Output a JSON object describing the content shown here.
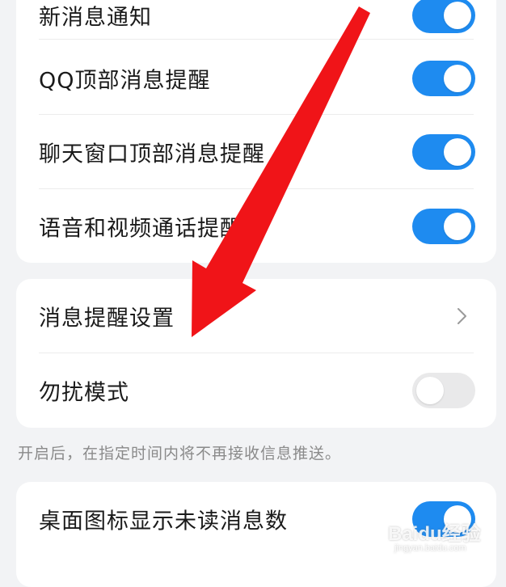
{
  "card1": {
    "rows": [
      {
        "label": "新消息通知",
        "toggle": "on"
      },
      {
        "label": "QQ顶部消息提醒",
        "toggle": "on"
      },
      {
        "label": "聊天窗口顶部消息提醒",
        "toggle": "on"
      },
      {
        "label": "语音和视频通话提醒",
        "toggle": "on"
      }
    ]
  },
  "card2": {
    "rows": [
      {
        "label": "消息提醒设置",
        "control": "chevron-right-icon"
      },
      {
        "label": "勿扰模式",
        "toggle": "off"
      }
    ]
  },
  "caption": "开启后，在指定时间内将不再接收信息推送。",
  "card3": {
    "rows": [
      {
        "label": "桌面图标显示未读消息数",
        "toggle": "on"
      }
    ]
  },
  "watermark": {
    "text": "Baidu经验",
    "url": "jingyan.baidu.com"
  },
  "colors": {
    "toggle_on": "#1e8bf0",
    "toggle_off": "#e9e9ea",
    "arrow": "#f01418",
    "background": "#f2f3f5"
  }
}
